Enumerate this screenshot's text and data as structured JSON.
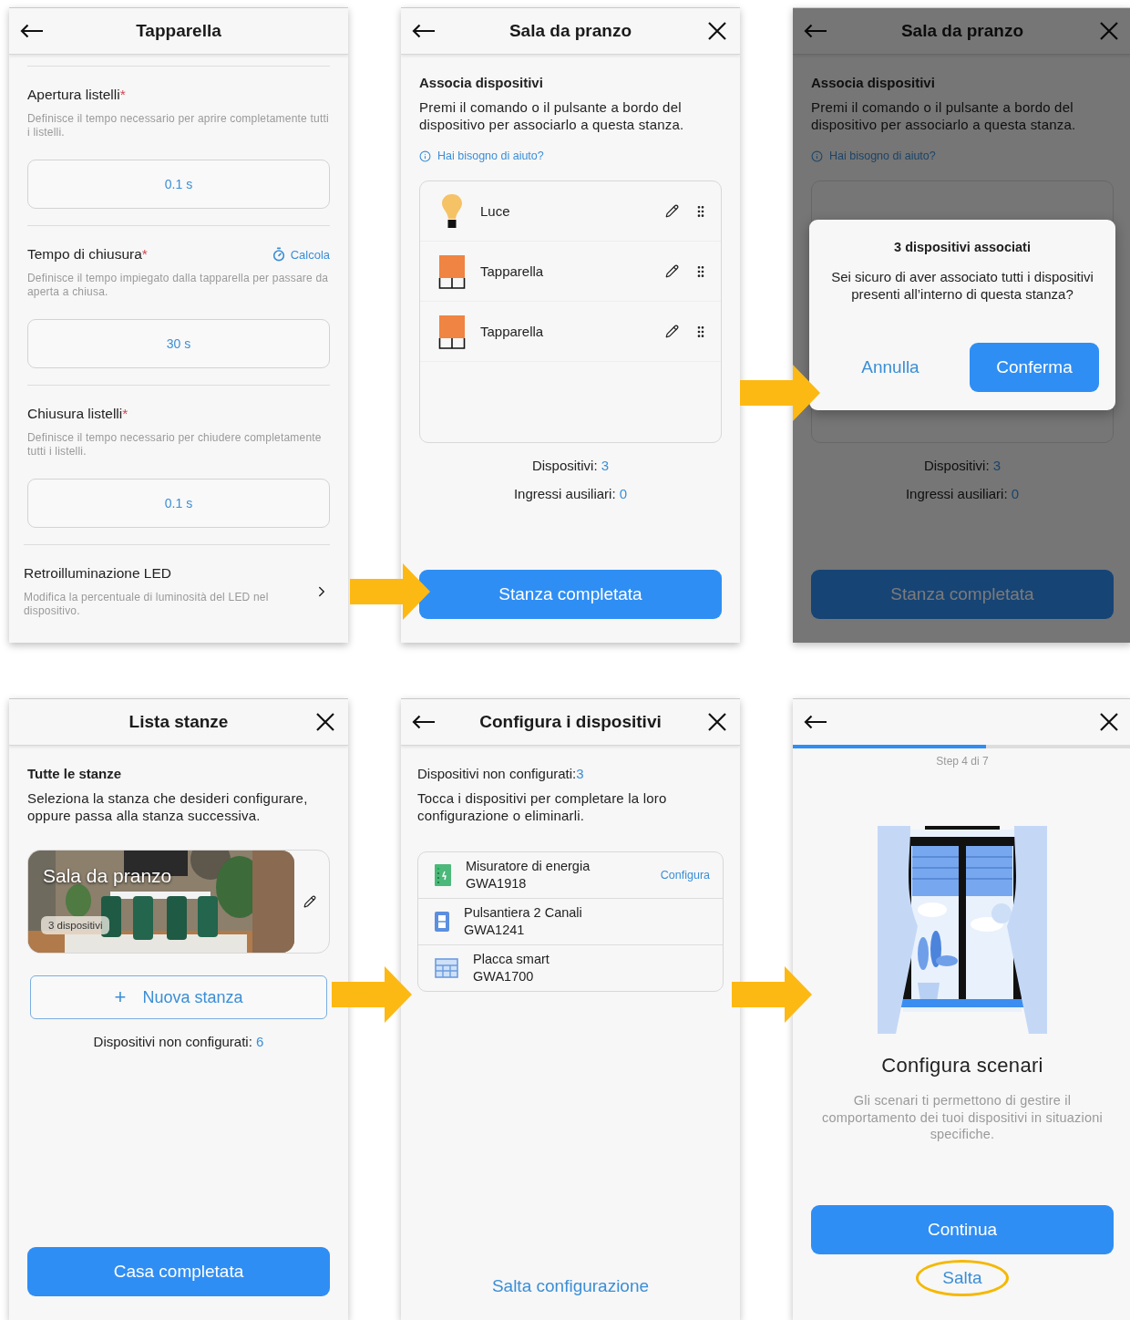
{
  "tapparella_screen": {
    "title": "Tapparella",
    "sections": [
      {
        "kind": "field",
        "label": "Apertura listelli",
        "required": "*",
        "description": "Definisce il tempo necessario per aprire completamente tutti i listelli.",
        "value": "0.1 s"
      },
      {
        "kind": "field",
        "label": "Tempo di chiusura",
        "required": "*",
        "action": "Calcola",
        "description": "Definisce il tempo impiegato dalla tapparella per passare da aperta a chiusa.",
        "value": "30 s"
      },
      {
        "kind": "field",
        "label": "Chiusura listelli",
        "required": "*",
        "description": "Definisce il tempo necessario per chiudere completamente tutti i listelli.",
        "value": "0.1 s"
      },
      {
        "kind": "link",
        "label": "Retroilluminazione LED",
        "description": "Modifica la percentuale di luminosità del LED nel dispositivo."
      }
    ]
  },
  "room_screen": {
    "title": "Sala da pranzo",
    "heading": "Associa dispositivi",
    "description": "Premi il comando o il pulsante a bordo del dispositivo per associarlo a questa stanza.",
    "help": "Hai bisogno di aiuto?",
    "devices": [
      {
        "kind": "bulb",
        "name": "Luce"
      },
      {
        "kind": "shutter",
        "name": "Tapparella"
      },
      {
        "kind": "shutter",
        "name": "Tapparella"
      }
    ],
    "stats": [
      {
        "label": "Dispositivi:",
        "value": "3"
      },
      {
        "label": "Ingressi ausiliari:",
        "value": "0"
      }
    ],
    "button": "Stanza completata"
  },
  "confirm_screen": {
    "title": "Sala da pranzo",
    "heading": "Associa dispositivi",
    "description": "Premi il comando o il pulsante a bordo del dispositivo per associarlo a questa stanza.",
    "help": "Hai bisogno di aiuto?",
    "stats": [
      {
        "label": "Dispositivi:",
        "value": "3"
      },
      {
        "label": "Ingressi ausiliari:",
        "value": "0"
      }
    ],
    "button": "Stanza completata",
    "dialog": {
      "title": "3 dispositivi associati",
      "message": "Sei sicuro di aver associato tutti i dispositivi presenti all’interno di questa stanza?",
      "cancel": "Annulla",
      "confirm": "Conferma"
    }
  },
  "room_list_screen": {
    "title": "Lista stanze",
    "heading": "Tutte le stanze",
    "description": "Seleziona la stanza che desideri configurare, oppure passa alla stanza successiva.",
    "rooms": [
      {
        "name": "Sala da pranzo",
        "badge": "3 dispositivi"
      }
    ],
    "new_room": {
      "icon": "+",
      "label": "Nuova stanza"
    },
    "stat": {
      "label": "Dispositivi non configurati:",
      "value": "6"
    },
    "button": "Casa completata"
  },
  "devices_screen": {
    "title": "Configura i dispositivi",
    "count_label": "Dispositivi non configurati:",
    "count": "3",
    "description": "Tocca i dispositivi per completare la loro configurazione o eliminarli.",
    "devices": [
      {
        "kind": "meter",
        "name": "Misuratore di energia",
        "code": "GWA1918",
        "action": "Configura"
      },
      {
        "kind": "keypad",
        "name": "Pulsantiera 2 Canali",
        "code": "GWA1241"
      },
      {
        "kind": "plate",
        "name": "Placca smart",
        "code": "GWA1700"
      }
    ],
    "skip": "Salta configurazione"
  },
  "scenarios_screen": {
    "progress": {
      "level": 0.57
    },
    "step": "Step 4 di 7",
    "title": "Configura scenari",
    "description": "Gli scenari ti permettono di gestire il comportamento dei tuoi dispositivi in situazioni specifiche.",
    "button": "Continua",
    "skip": {
      "label": "Salta",
      "highlighted": true
    }
  }
}
